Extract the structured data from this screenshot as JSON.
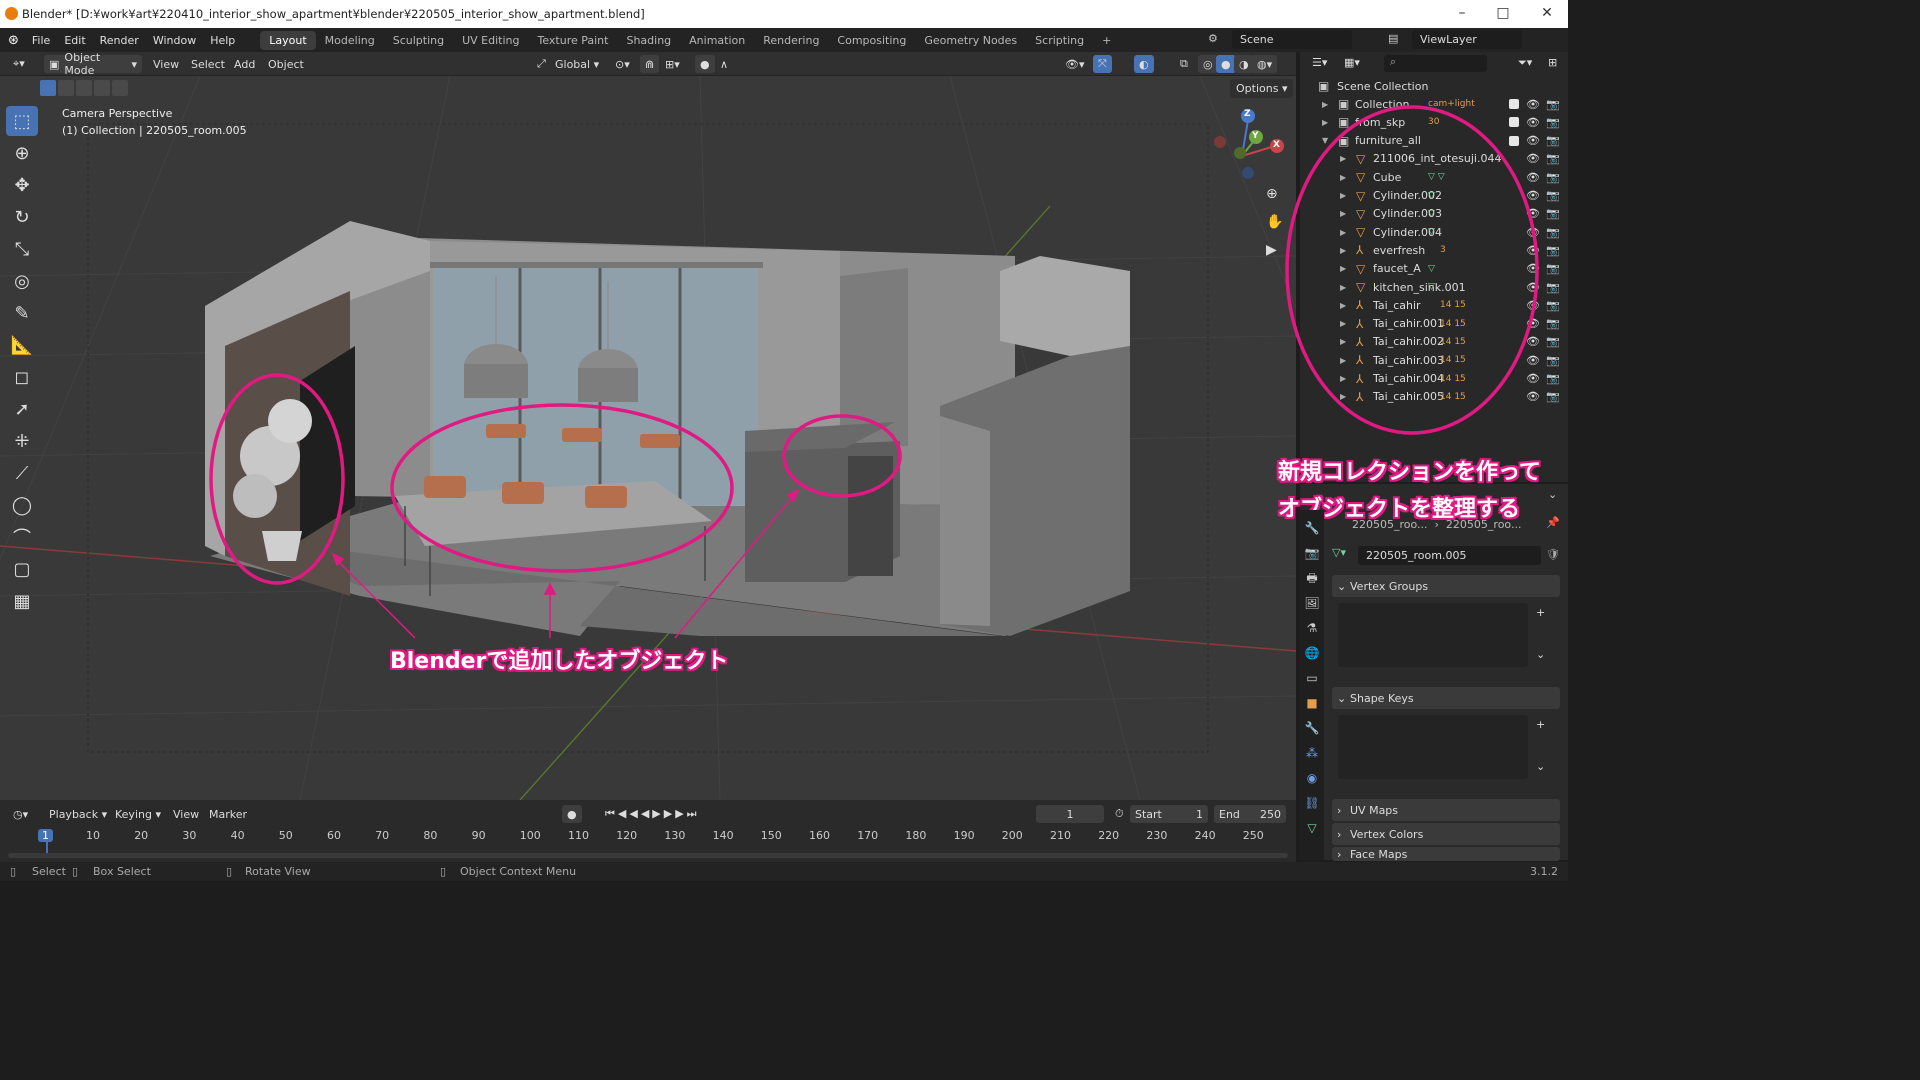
{
  "window": {
    "title": "Blender* [D:¥work¥art¥220410_interior_show_apartment¥blender¥220505_interior_show_apartment.blend]",
    "min": "–",
    "max": "□",
    "close": "✕"
  },
  "menu": {
    "items": [
      "File",
      "Edit",
      "Render",
      "Window",
      "Help"
    ],
    "workspaces": [
      "Layout",
      "Modeling",
      "Sculpting",
      "UV Editing",
      "Texture Paint",
      "Shading",
      "Animation",
      "Rendering",
      "Compositing",
      "Geometry Nodes",
      "Scripting"
    ],
    "add": "+",
    "scene": "Scene",
    "viewlayer": "ViewLayer"
  },
  "header3d": {
    "mode": "Object Mode",
    "view": "View",
    "select": "Select",
    "add": "Add",
    "object": "Object",
    "orientation": "Global",
    "options": "Options"
  },
  "viewport": {
    "overlay_line1": "Camera Perspective",
    "overlay_line2": "(1) Collection | 220505_room.005",
    "gizmo": {
      "z": "Z",
      "y": "Y",
      "x": "X"
    }
  },
  "tools": [
    "select-box",
    "cursor",
    "move",
    "rotate",
    "scale",
    "transform",
    "annotate",
    "measure",
    "add-cube",
    "select-cursor",
    "extrude",
    "knife",
    "circle",
    "curve",
    "plane",
    "grid"
  ],
  "outliner": {
    "root": "Scene Collection",
    "rows": [
      {
        "name": "Collection",
        "type": "collection",
        "extra": "cam+light"
      },
      {
        "name": "from_skp",
        "type": "collection",
        "extra": "30"
      },
      {
        "name": "furniture_all",
        "type": "collection",
        "extra": ""
      },
      {
        "name": "211006_int_otesuji.044",
        "type": "mesh",
        "extra": ""
      },
      {
        "name": "Cube",
        "type": "mesh",
        "extra": "mesh2"
      },
      {
        "name": "Cylinder.002",
        "type": "mesh",
        "extra": "mesh"
      },
      {
        "name": "Cylinder.003",
        "type": "mesh",
        "extra": "mesh"
      },
      {
        "name": "Cylinder.004",
        "type": "mesh",
        "extra": "mesh"
      },
      {
        "name": "everfresh",
        "type": "armature",
        "extra": "3"
      },
      {
        "name": "faucet_A",
        "type": "mesh",
        "extra": "mesh"
      },
      {
        "name": "kitchen_sink.001",
        "type": "mesh",
        "extra": "mesh"
      },
      {
        "name": "Tai_cahir",
        "type": "armature",
        "extra": "14 15"
      },
      {
        "name": "Tai_cahir.001",
        "type": "armature",
        "extra": "14 15"
      },
      {
        "name": "Tai_cahir.002",
        "type": "armature",
        "extra": "14 15"
      },
      {
        "name": "Tai_cahir.003",
        "type": "armature",
        "extra": "14 15"
      },
      {
        "name": "Tai_cahir.004",
        "type": "armature",
        "extra": "14 15"
      },
      {
        "name": "Tai_cahir.005",
        "type": "armature",
        "extra": "14 15"
      }
    ]
  },
  "properties": {
    "breadcrumb1": "220505_roo...",
    "breadcrumb2": "220505_roo...",
    "mesh_name": "220505_room.005",
    "panels": [
      "Vertex Groups",
      "Shape Keys",
      "UV Maps",
      "Vertex Colors",
      "Face Maps"
    ]
  },
  "timeline": {
    "playback": "Playback",
    "keying": "Keying",
    "view": "View",
    "marker": "Marker",
    "current": "1",
    "start_label": "Start",
    "start": "1",
    "end_label": "End",
    "end": "250",
    "frames": [
      "1",
      "10",
      "20",
      "30",
      "40",
      "50",
      "60",
      "70",
      "80",
      "90",
      "100",
      "110",
      "120",
      "130",
      "140",
      "150",
      "160",
      "170",
      "180",
      "190",
      "200",
      "210",
      "220",
      "230",
      "240",
      "250"
    ]
  },
  "status": {
    "select": "Select",
    "box": "Box Select",
    "rotate": "Rotate View",
    "context": "Object Context Menu",
    "version": "3.1.2"
  },
  "annotations": {
    "left": "Blenderで追加したオブジェクト",
    "right1": "新規コレクションを作って",
    "right2": "オブジェクトを整理する"
  },
  "colors": {
    "accent": "#4772b3",
    "annotation": "#e01a82",
    "mesh_icon": "#e49e4b"
  }
}
